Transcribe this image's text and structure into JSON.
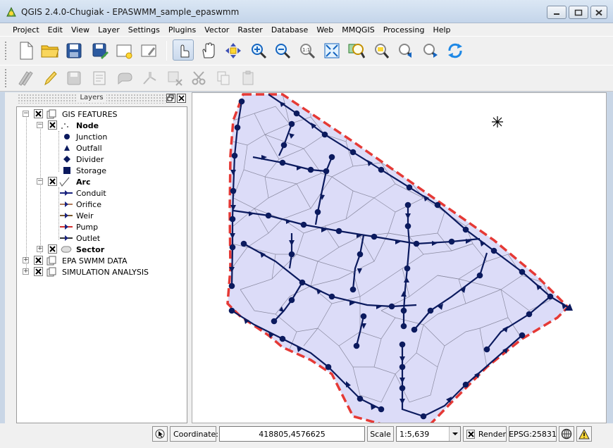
{
  "window": {
    "title": "QGIS 2.4.0-Chugiak - EPASWMM_sample_epaswmm",
    "icons": {
      "app": "qgis-logo-icon",
      "minimize": "minimize-icon",
      "maximize": "maximize-icon",
      "close": "close-icon"
    }
  },
  "menubar": {
    "items": [
      "Project",
      "Edit",
      "View",
      "Layer",
      "Settings",
      "Plugins",
      "Vector",
      "Raster",
      "Database",
      "Web",
      "MMQGIS",
      "Processing",
      "Help"
    ]
  },
  "toolbar_main": {
    "buttons": [
      "new-project-icon",
      "open-project-icon",
      "save-project-icon",
      "save-as-icon",
      "new-print-composer-icon",
      "composer-manager-icon",
      "touch-zoom-icon",
      "pan-icon",
      "pan-to-selection-icon",
      "zoom-in-icon",
      "zoom-out-icon",
      "zoom-actual-size-icon",
      "zoom-full-icon",
      "zoom-to-layer-icon",
      "zoom-to-selection-icon",
      "zoom-last-icon",
      "zoom-next-icon",
      "refresh-icon"
    ]
  },
  "toolbar_edit": {
    "buttons": [
      "current-edits-icon",
      "toggle-editing-icon",
      "save-layer-edits-icon",
      "add-feature-icon",
      "move-feature-icon",
      "node-tool-icon",
      "delete-selected-icon",
      "cut-features-icon",
      "copy-features-icon",
      "paste-features-icon"
    ]
  },
  "layers_panel": {
    "title": "Layers",
    "tree": [
      {
        "label": "GIS FEATURES",
        "bold": false
      },
      {
        "label": "Node",
        "bold": true
      },
      {
        "label": "Junction",
        "symbol": "circle"
      },
      {
        "label": "Outfall",
        "symbol": "triangle"
      },
      {
        "label": "Divider",
        "symbol": "diamond"
      },
      {
        "label": "Storage",
        "symbol": "square"
      },
      {
        "label": "Arc",
        "bold": true
      },
      {
        "label": "Conduit",
        "symbol": "arrow",
        "color": "#1a237e"
      },
      {
        "label": "Orifice",
        "symbol": "arrow",
        "color": "#b07b5a"
      },
      {
        "label": "Weir",
        "symbol": "arrow",
        "color": "#7a5a2e"
      },
      {
        "label": "Pump",
        "symbol": "arrow",
        "color": "#d32f2f"
      },
      {
        "label": "Outlet",
        "symbol": "arrow",
        "color": "#333333"
      },
      {
        "label": "Sector",
        "bold": true
      },
      {
        "label": "EPA SWMM DATA",
        "bold": false
      },
      {
        "label": "SIMULATION ANALYSIS",
        "bold": false
      }
    ]
  },
  "map": {
    "colors": {
      "area_fill": "#dcdcf8",
      "boundary": "#e53935",
      "network": "#0b1a5e",
      "cells": "#8a8aa0"
    }
  },
  "statusbar": {
    "coordinate_label": "Coordinate:",
    "coordinate_value": "418805,4576625",
    "scale_label": "Scale",
    "scale_value": "1:5,639",
    "render_label": "Render",
    "render_checked": true,
    "crs": "EPSG:25831",
    "icons": {
      "messages": "mouse-pointer-icon",
      "crs": "globe-crs-icon",
      "warning": "warning-icon",
      "dropdown": "chevron-down-icon"
    }
  }
}
